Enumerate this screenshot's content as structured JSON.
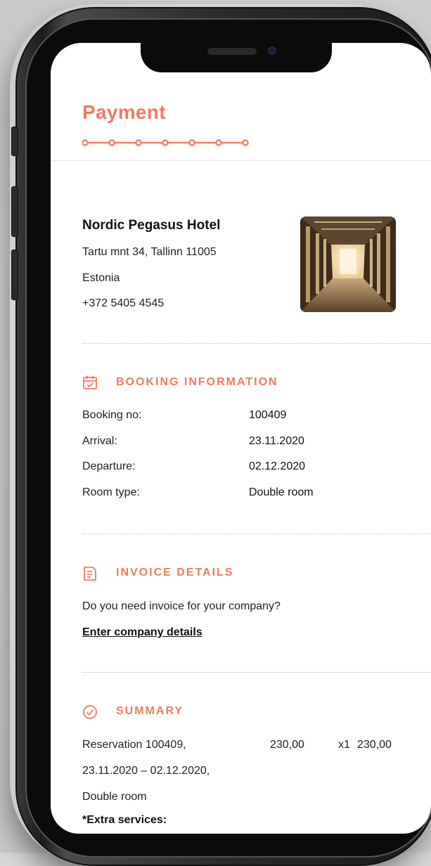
{
  "header": {
    "title": "Payment",
    "steps_total": 7
  },
  "hotel": {
    "name": "Nordic Pegasus Hotel",
    "address": "Tartu mnt 34, Tallinn 11005",
    "country": "Estonia",
    "phone": "+372 5405 4545"
  },
  "booking": {
    "section_title": "BOOKING INFORMATION",
    "rows": [
      {
        "label": "Booking no:",
        "value": "100409"
      },
      {
        "label": "Arrival:",
        "value": "23.11.2020"
      },
      {
        "label": "Departure:",
        "value": "02.12.2020"
      },
      {
        "label": "Room type:",
        "value": "Double room"
      }
    ]
  },
  "invoice": {
    "section_title": "INVOICE DETAILS",
    "question": "Do you need invoice for your company?",
    "link_label": "Enter company details"
  },
  "summary": {
    "section_title": "SUMMARY",
    "item_lines": [
      "Reservation 100409,",
      "23.11.2020 – 02.12.2020,",
      "Double room"
    ],
    "unit_price": "230,00",
    "quantity": "x1",
    "total": "230,00",
    "extras_label": "*Extra services:"
  },
  "colors": {
    "accent": "#f07b5e",
    "text": "#111111"
  },
  "icons": {
    "booking": "calendar-check-icon",
    "invoice": "document-icon",
    "summary": "check-circle-icon"
  }
}
